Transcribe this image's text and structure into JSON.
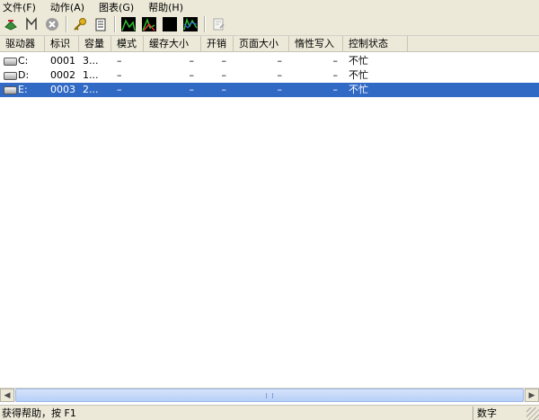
{
  "menu": [
    {
      "label": "文件(F)"
    },
    {
      "label": "动作(A)"
    },
    {
      "label": "图表(G)"
    },
    {
      "label": "帮助(H)"
    }
  ],
  "toolbar_icons": [
    "refresh-icon",
    "marker-icon",
    "stop-icon",
    "key-icon",
    "clipboard-icon",
    "chart-read-icon",
    "chart-write-icon",
    "chart-black-icon",
    "chart-combined-icon",
    "notes-icon"
  ],
  "columns": [
    "驱动器",
    "标识",
    "容量",
    "模式",
    "缓存大小",
    "开销",
    "页面大小",
    "惰性写入",
    "控制状态"
  ],
  "rows": [
    {
      "drive": "C:",
      "id": "0001",
      "capacity": "3...",
      "mode": "–",
      "cache": "–",
      "overhead": "–",
      "page_a": "–",
      "page_b": "–",
      "status": "不忙",
      "selected": false
    },
    {
      "drive": "D:",
      "id": "0002",
      "capacity": "1...",
      "mode": "–",
      "cache": "–",
      "overhead": "–",
      "page_a": "–",
      "page_b": "–",
      "status": "不忙",
      "selected": false
    },
    {
      "drive": "E:",
      "id": "0003",
      "capacity": "2...",
      "mode": "–",
      "cache": "–",
      "overhead": "–",
      "page_a": "–",
      "page_b": "–",
      "status": "不忙",
      "selected": true
    }
  ],
  "status": {
    "help_text": "获得帮助，按 F1",
    "panel": "数字"
  },
  "colors": {
    "selection": "#316ac5",
    "chrome": "#ece9d8"
  }
}
